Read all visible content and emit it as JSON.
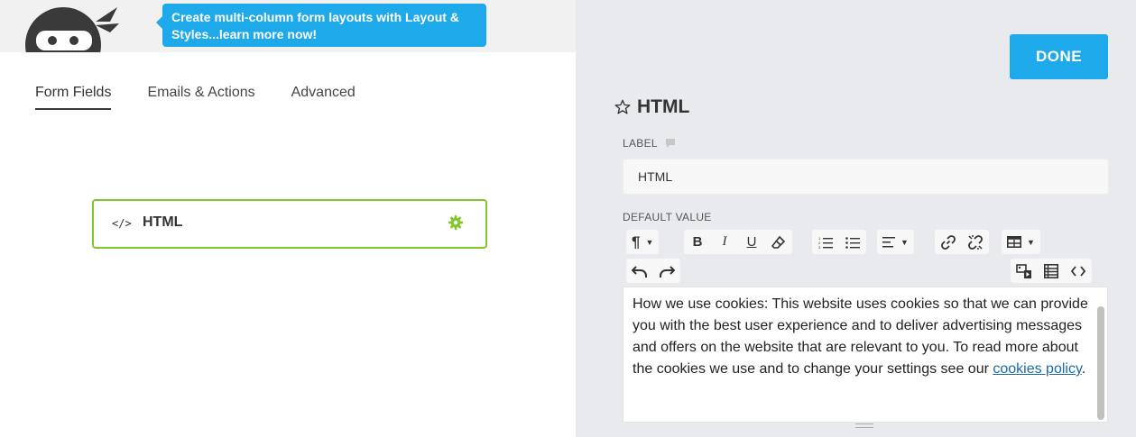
{
  "tooltip": {
    "text": "Create multi-column form layouts with Layout & Styles...learn more now!"
  },
  "tabs": [
    {
      "label": "Form Fields",
      "active": true
    },
    {
      "label": "Emails & Actions",
      "active": false
    },
    {
      "label": "Advanced",
      "active": false
    }
  ],
  "field_card": {
    "icon_text": "</>",
    "title": "HTML",
    "accent": "#80c72a"
  },
  "right": {
    "done_label": "DONE",
    "title": "HTML",
    "label_caption": "LABEL",
    "label_value": "HTML",
    "default_caption": "DEFAULT VALUE",
    "editor": {
      "text": "How we use cookies: This website uses cookies so that we can provide you with the best user experience and to deliver advertising messages and offers on the website that are relevant to you. To read more about the cookies we use and to change your settings see our ",
      "link_text": "cookies policy",
      "tail": "."
    }
  },
  "toolbar": {
    "paragraph": "¶",
    "bold": "B",
    "italic": "I",
    "underline": "U"
  },
  "colors": {
    "accent_blue": "#1ea9ea",
    "accent_green": "#80c72a",
    "link": "#1a6aa6"
  }
}
